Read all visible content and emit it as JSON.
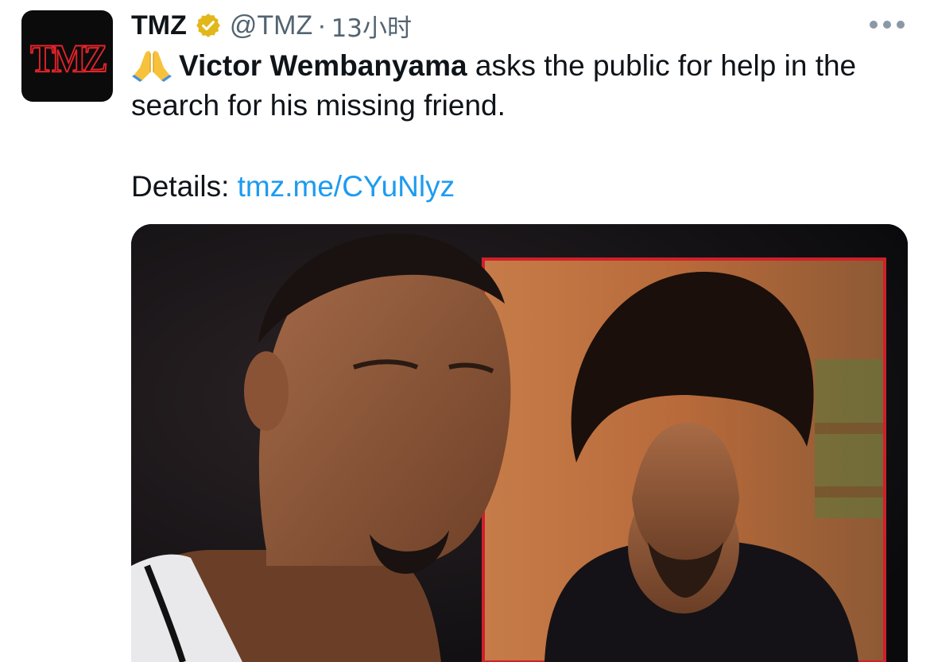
{
  "tweet": {
    "account_name": "TMZ",
    "handle": "@TMZ",
    "separator": "·",
    "time": "13小时",
    "avatar_logo": "TMZ",
    "verified_icon": "verified-badge-icon",
    "more_icon": "more-options-icon",
    "emoji": "folded-hands-icon",
    "bold_name": "Victor Wembanyama",
    "text_rest": " asks the public for help in the search for his missing friend.",
    "details_label": "Details: ",
    "link_text": "tmz.me/CYuNlyz",
    "colors": {
      "link": "#1d9bf0",
      "muted": "#536471",
      "verified_gold": "#e2b719",
      "tmz_red": "#e4232a"
    }
  }
}
